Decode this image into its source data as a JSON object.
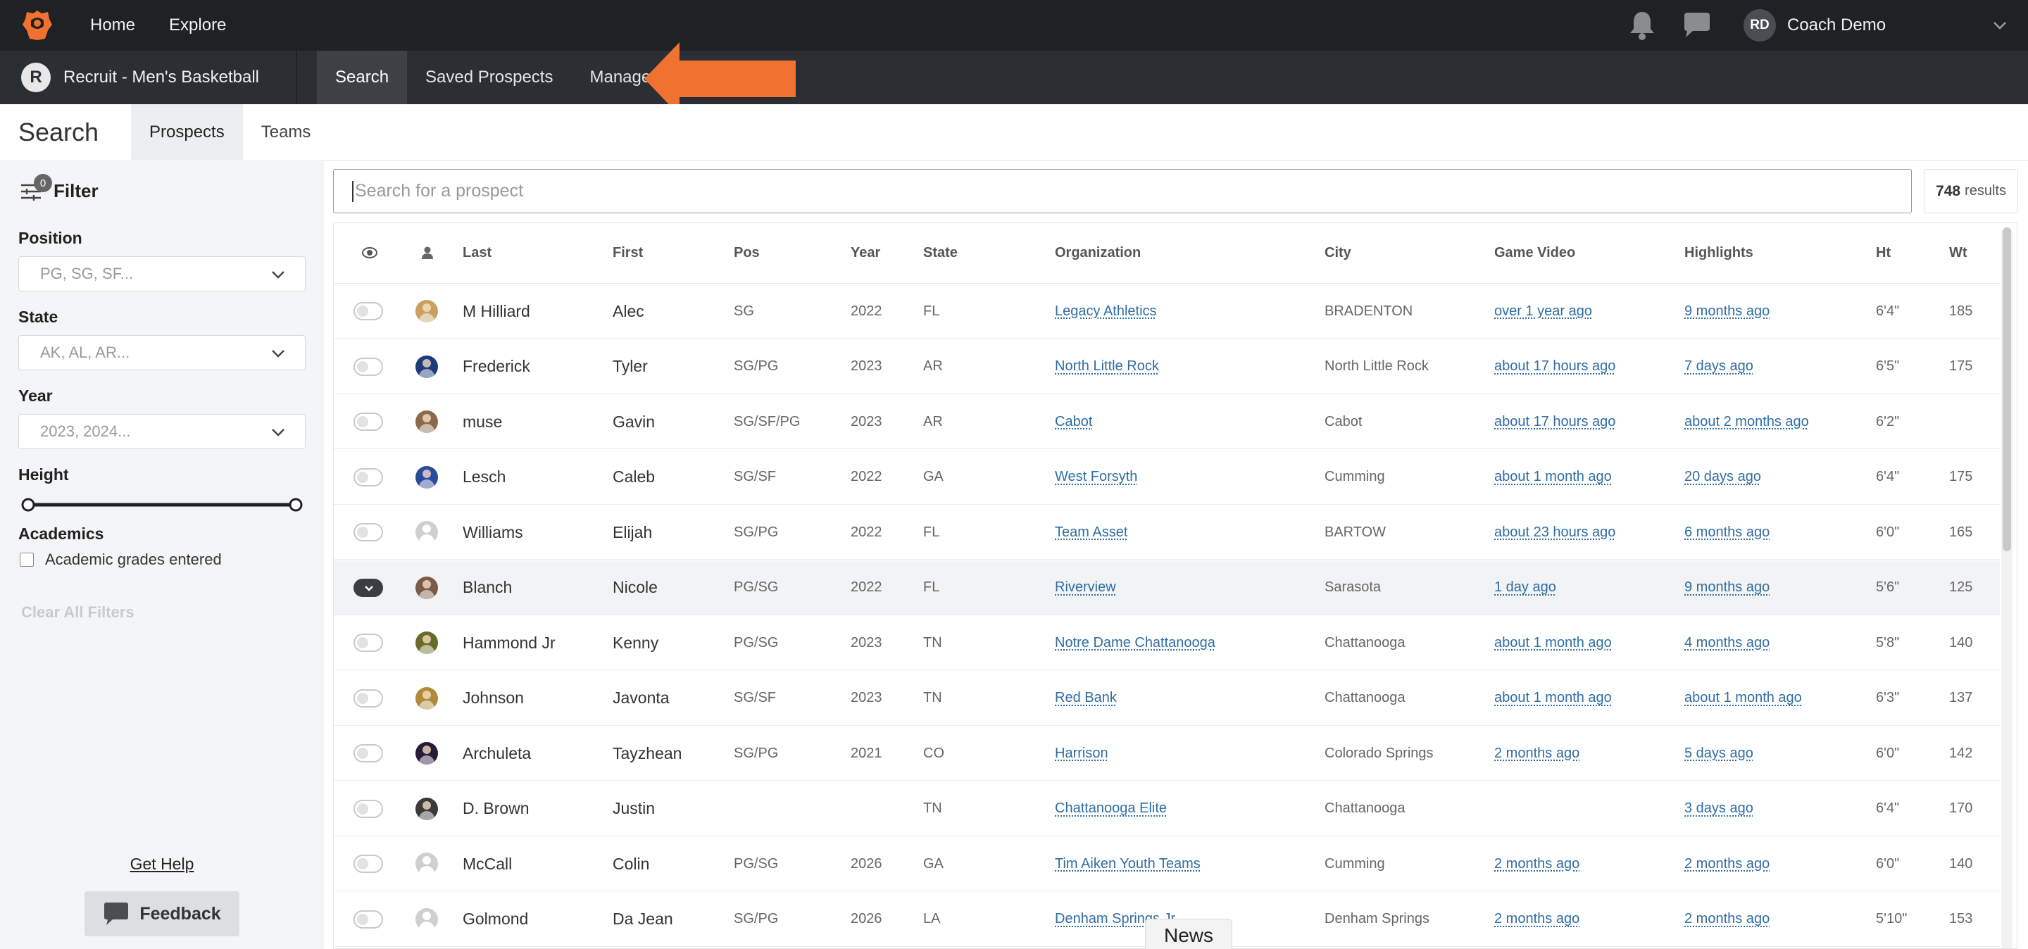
{
  "topbar": {
    "nav": [
      "Home",
      "Explore"
    ],
    "user_initials": "RD",
    "user_name": "Coach Demo"
  },
  "subbar": {
    "app_initial": "R",
    "app_title": "Recruit - Men's Basketball",
    "tabs": [
      "Search",
      "Saved Prospects",
      "Manage"
    ],
    "active_tab": "Search",
    "arrow_color": "#f07130"
  },
  "page": {
    "title": "Search",
    "tabs": [
      "Prospects",
      "Teams"
    ],
    "active_tab": "Prospects"
  },
  "sidebar": {
    "filter_label": "Filter",
    "filter_count": "0",
    "position_label": "Position",
    "position_placeholder": "PG, SG, SF...",
    "state_label": "State",
    "state_placeholder": "AK, AL, AR...",
    "year_label": "Year",
    "year_placeholder": "2023, 2024...",
    "height_label": "Height",
    "academics_label": "Academics",
    "academics_checkbox": "Academic grades entered",
    "clear_all": "Clear All Filters",
    "get_help": "Get Help",
    "feedback": "Feedback"
  },
  "search": {
    "placeholder": "Search for a prospect",
    "results_count": "748",
    "results_label": "results"
  },
  "table": {
    "headers": [
      "Last",
      "First",
      "Pos",
      "Year",
      "State",
      "Organization",
      "City",
      "Game Video",
      "Highlights",
      "Ht",
      "Wt"
    ],
    "rows": [
      {
        "last": "M Hilliard",
        "first": "Alec",
        "pos": "SG",
        "year": "2022",
        "state": "FL",
        "org": "Legacy Athletics",
        "city": "BRADENTON",
        "video": "over 1 year ago",
        "highlights": "9 months ago",
        "ht": "6'4\"",
        "wt": "185",
        "selected": false,
        "avatar": "#c8a060"
      },
      {
        "last": "Frederick",
        "first": "Tyler",
        "pos": "SG/PG",
        "year": "2023",
        "state": "AR",
        "org": "North Little Rock",
        "city": "North Little Rock",
        "video": "about 17 hours ago",
        "highlights": "7 days ago",
        "ht": "6'5\"",
        "wt": "175",
        "selected": false,
        "avatar": "#1d3a7a"
      },
      {
        "last": "muse",
        "first": "Gavin",
        "pos": "SG/SF/PG",
        "year": "2023",
        "state": "AR",
        "org": "Cabot",
        "city": "Cabot",
        "video": "about 17 hours ago",
        "highlights": "about 2 months ago",
        "ht": "6'2\"",
        "wt": "",
        "selected": false,
        "avatar": "#8a6a4a"
      },
      {
        "last": "Lesch",
        "first": "Caleb",
        "pos": "SG/SF",
        "year": "2022",
        "state": "GA",
        "org": "West Forsyth",
        "city": "Cumming",
        "video": "about 1 month ago",
        "highlights": "20 days ago",
        "ht": "6'4\"",
        "wt": "175",
        "selected": false,
        "avatar": "#2a4a9a"
      },
      {
        "last": "Williams",
        "first": "Elijah",
        "pos": "SG/PG",
        "year": "2022",
        "state": "FL",
        "org": "Team Asset",
        "city": "BARTOW",
        "video": "about 23 hours ago",
        "highlights": "6 months ago",
        "ht": "6'0\"",
        "wt": "165",
        "selected": false,
        "avatar": ""
      },
      {
        "last": "Blanch",
        "first": "Nicole",
        "pos": "PG/SG",
        "year": "2022",
        "state": "FL",
        "org": "Riverview",
        "city": "Sarasota",
        "video": "1 day ago",
        "highlights": "9 months ago",
        "ht": "5'6\"",
        "wt": "125",
        "selected": true,
        "avatar": "#7a5a48"
      },
      {
        "last": "Hammond Jr",
        "first": "Kenny",
        "pos": "PG/SG",
        "year": "2023",
        "state": "TN",
        "org": "Notre Dame Chattanooga",
        "city": "Chattanooga",
        "video": "about 1 month ago",
        "highlights": "4 months ago",
        "ht": "5'8\"",
        "wt": "140",
        "selected": false,
        "avatar": "#6a6a2a"
      },
      {
        "last": "Johnson",
        "first": "Javonta",
        "pos": "SG/SF",
        "year": "2023",
        "state": "TN",
        "org": "Red Bank",
        "city": "Chattanooga",
        "video": "about 1 month ago",
        "highlights": "about 1 month ago",
        "ht": "6'3\"",
        "wt": "137",
        "selected": false,
        "avatar": "#b08a3a"
      },
      {
        "last": "Archuleta",
        "first": "Tayzhean",
        "pos": "SG/PG",
        "year": "2021",
        "state": "CO",
        "org": "Harrison",
        "city": "Colorado Springs",
        "video": "2 months ago",
        "highlights": "5 days ago",
        "ht": "6'0\"",
        "wt": "142",
        "selected": false,
        "avatar": "#2a1a3a"
      },
      {
        "last": "D. Brown",
        "first": "Justin",
        "pos": "",
        "year": "",
        "state": "TN",
        "org": "Chattanooga Elite",
        "city": "Chattanooga",
        "video": "",
        "highlights": "3 days ago",
        "ht": "6'4\"",
        "wt": "170",
        "selected": false,
        "avatar": "#3a3a3a"
      },
      {
        "last": "McCall",
        "first": "Colin",
        "pos": "PG/SG",
        "year": "2026",
        "state": "GA",
        "org": "Tim Aiken Youth Teams",
        "city": "Cumming",
        "video": "2 months ago",
        "highlights": "2 months ago",
        "ht": "6'0\"",
        "wt": "140",
        "selected": false,
        "avatar": ""
      },
      {
        "last": "Golmond",
        "first": "Da Jean",
        "pos": "SG/PG",
        "year": "2026",
        "state": "LA",
        "org": "Denham Springs Jr",
        "city": "Denham Springs",
        "video": "2 months ago",
        "highlights": "2 months ago",
        "ht": "5'10\"",
        "wt": "153",
        "selected": false,
        "avatar": ""
      }
    ]
  },
  "news_tab": "News",
  "colors": {
    "accent": "#f07130",
    "link": "#2f6da3",
    "topbar": "#1f2124",
    "subbar": "#2b2e32"
  }
}
